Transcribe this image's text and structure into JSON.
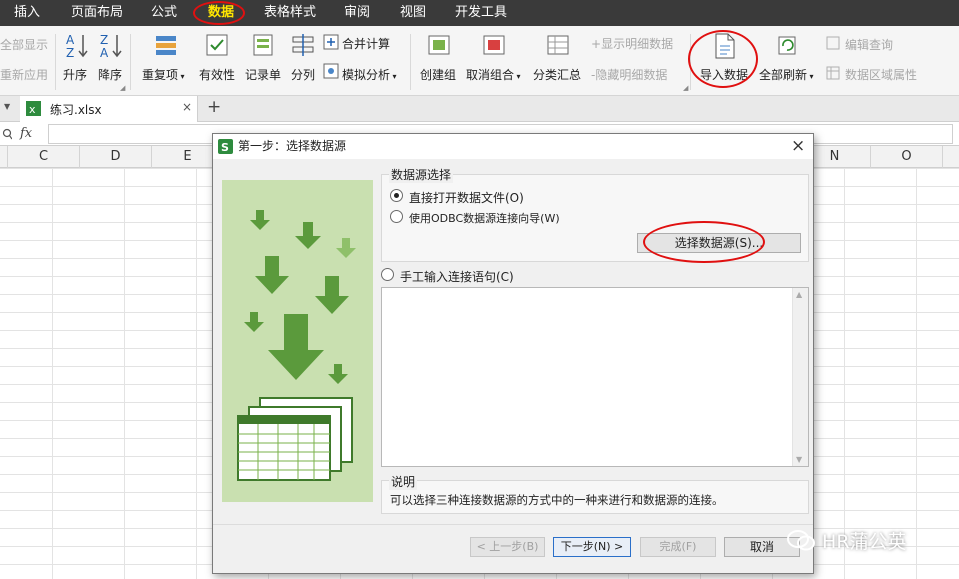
{
  "menu": {
    "items": [
      "插入",
      "页面布局",
      "公式",
      "数据",
      "表格样式",
      "审阅",
      "视图",
      "开发工具"
    ],
    "active_index": 3
  },
  "ribbon": {
    "show_all": "全部显示",
    "reapply": "重新应用",
    "sort_asc": "升序",
    "sort_desc": "降序",
    "duplicates": "重复项",
    "validity": "有效性",
    "record_form": "记录单",
    "split_column": "分列",
    "consolidate": "合并计算",
    "what_if": "模拟分析",
    "create_group": "创建组",
    "ungroup": "取消组合",
    "subtotal": "分类汇总",
    "show_detail": "显示明细数据",
    "hide_detail": "隐藏明细数据",
    "import_data": "导入数据",
    "refresh_all": "全部刷新",
    "edit_query": "编辑查询",
    "data_range_props": "数据区域属性"
  },
  "tabs": {
    "file_name": "练习.xlsx",
    "new_tab": "+"
  },
  "formula": {
    "fx": "fx",
    "value": ""
  },
  "columns": [
    "C",
    "D",
    "E",
    "N",
    "O"
  ],
  "dialog": {
    "title": "第一步：选择数据源",
    "close": "×",
    "group_source_title": "数据源选择",
    "option_open_file": "直接打开数据文件(O)",
    "option_odbc": "使用ODBC数据源连接向导(W)",
    "select_source_button": "选择数据源(S)...",
    "option_manual": "手工输入连接语句(C)",
    "manual_text": "",
    "desc_title": "说明",
    "desc_text": "可以选择三种连接数据源的方式中的一种来进行和数据源的连接。",
    "btn_prev": "< 上一步(B)",
    "btn_next": "下一步(N) >",
    "btn_finish": "完成(F)",
    "btn_cancel": "取消"
  },
  "watermark": "HR蒲公英",
  "colors": {
    "menubar": "#3a3a3a",
    "active_menu": "#ffe600",
    "annotation": "#e01010",
    "illustration_bg": "#c9e0b0",
    "arrow_green": "#5b9a3c"
  }
}
